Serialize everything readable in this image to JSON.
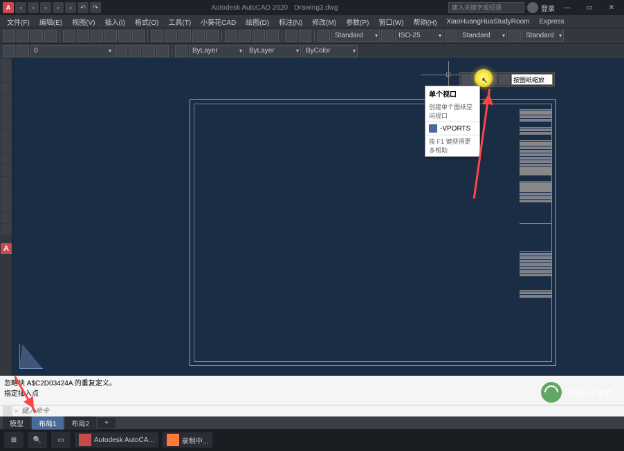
{
  "title": {
    "app": "Autodesk AutoCAD 2020",
    "doc": "Drawing3.dwg"
  },
  "search": {
    "placeholder": "建入关键字或短语"
  },
  "user": {
    "label": "登录"
  },
  "menu": [
    "文件(F)",
    "编辑(E)",
    "视图(V)",
    "插入(I)",
    "格式(O)",
    "工具(T)",
    "小葵花CAD",
    "绘图(D)",
    "标注(N)",
    "修改(M)",
    "参数(P)",
    "窗口(W)",
    "帮助(H)",
    "XiaoHuangHuaStudyRoom",
    "Express"
  ],
  "layer": {
    "dd1": "0",
    "dd2": "ByLayer",
    "dd3": "ByLayer",
    "dd4": "ByColor"
  },
  "styles": {
    "text": "Standard",
    "dim": "ISO-25",
    "table": "Standard",
    "mleader": "Standard"
  },
  "float_dd": "按图纸缩放",
  "tooltip": {
    "title": "单个视口",
    "sub": "创建单个图纸空间视口",
    "cmd": "-VPORTS",
    "help": "按 F1 键获得更多帮助"
  },
  "cmd": {
    "line1": "忽略块 A$C2D03424A 的重复定义。",
    "line2": "指定插入点",
    "prompt": "键入命令"
  },
  "tabs": [
    "模型",
    "布局1",
    "布局2"
  ],
  "taskbar": {
    "app1": "Autodesk AutoCA...",
    "app2": "录制中..."
  },
  "watermark": "天正CAD自学",
  "sidebar": {
    "a": "A"
  }
}
